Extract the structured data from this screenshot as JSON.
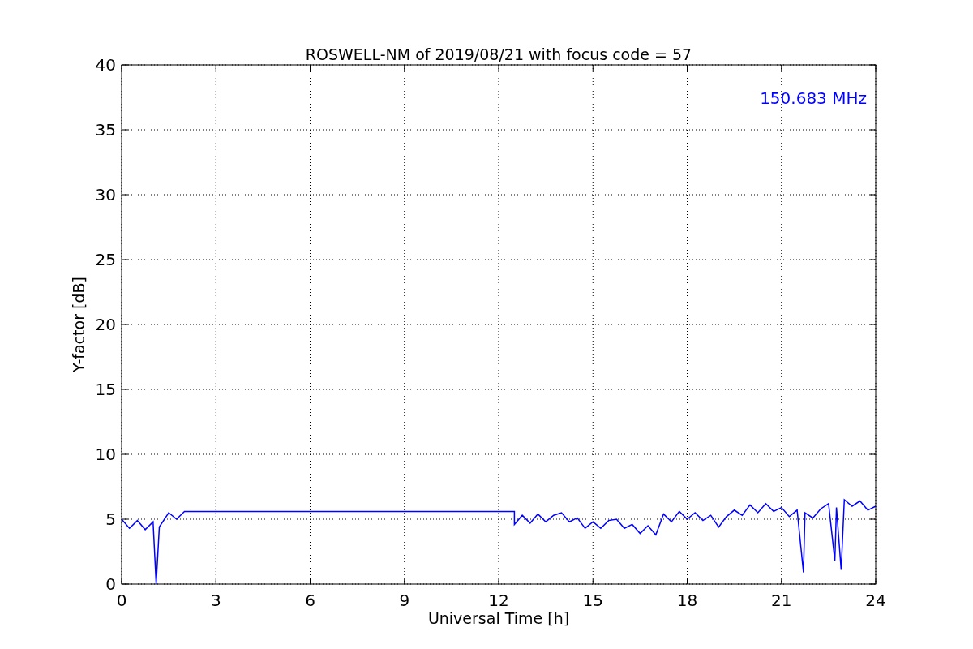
{
  "chart_data": {
    "type": "line",
    "title": "ROSWELL-NM of 2019/08/21 with focus code = 57",
    "xlabel": "Universal Time [h]",
    "ylabel": "Y-factor [dB]",
    "x": [
      0,
      0.25,
      0.5,
      0.75,
      1,
      1.1,
      1.2,
      1.5,
      1.75,
      2,
      12.5,
      12.5,
      12.75,
      13,
      13.25,
      13.5,
      13.75,
      14,
      14.25,
      14.5,
      14.75,
      15,
      15.25,
      15.5,
      15.75,
      16,
      16.25,
      16.5,
      16.75,
      17,
      17.25,
      17.5,
      17.75,
      18,
      18.25,
      18.5,
      18.75,
      19,
      19.25,
      19.5,
      19.75,
      20,
      20.25,
      20.5,
      20.75,
      21,
      21.25,
      21.5,
      21.7,
      21.75,
      22,
      22.25,
      22.5,
      22.7,
      22.75,
      22.9,
      23,
      23.25,
      23.5,
      23.75,
      24
    ],
    "series": [
      {
        "name": "150.683 MHz",
        "color": "#0000ff",
        "values": [
          5.0,
          4.3,
          4.9,
          4.2,
          4.8,
          0,
          4.4,
          5.5,
          5.0,
          5.6,
          5.6,
          4.6,
          5.3,
          4.7,
          5.4,
          4.8,
          5.3,
          5.5,
          4.8,
          5.1,
          4.3,
          4.8,
          4.3,
          4.9,
          5.0,
          4.3,
          4.6,
          3.9,
          4.5,
          3.8,
          5.4,
          4.8,
          5.6,
          5.0,
          5.5,
          4.9,
          5.3,
          4.4,
          5.2,
          5.7,
          5.3,
          6.1,
          5.5,
          6.2,
          5.6,
          5.9,
          5.2,
          5.7,
          0.9,
          5.5,
          5.1,
          5.8,
          6.2,
          1.8,
          5.9,
          1.1,
          6.5,
          6.0,
          6.4,
          5.7,
          6.0
        ]
      }
    ],
    "xlim": [
      0,
      24
    ],
    "ylim": [
      0,
      40
    ],
    "xticks": [
      0,
      3,
      6,
      9,
      12,
      15,
      18,
      21,
      24
    ],
    "yticks": [
      0,
      5,
      10,
      15,
      20,
      25,
      30,
      35,
      40
    ],
    "grid": true
  }
}
